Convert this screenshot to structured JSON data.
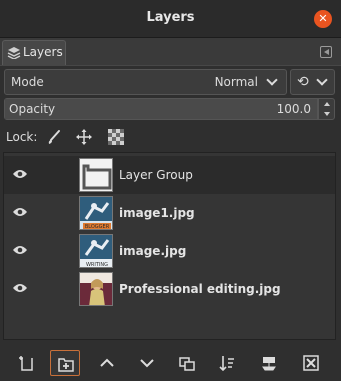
{
  "window": {
    "title": "Layers"
  },
  "dock": {
    "tab_label": "Layers"
  },
  "mode": {
    "label": "Mode",
    "value": "Normal"
  },
  "opacity": {
    "label": "Opacity",
    "value": "100.0",
    "level": 1.0
  },
  "lock": {
    "label": "Lock:"
  },
  "layers": [
    {
      "name": "Layer Group",
      "bold": false,
      "selected": true
    },
    {
      "name": "image1.jpg",
      "bold": true,
      "selected": false
    },
    {
      "name": "image.jpg",
      "bold": true,
      "selected": false
    },
    {
      "name": "Professional editing.jpg",
      "bold": true,
      "selected": false
    }
  ],
  "thumb_texts": {
    "image1": "BLOGGER",
    "image": "WRITING"
  },
  "colors": {
    "accent": "#e95420",
    "active_border": "#c8703a",
    "selected_row": "#2b2b2b"
  },
  "icons": {
    "close": "close-icon",
    "tab": "layers-icon",
    "composite": "composite-mode-icon",
    "lock_pixels": "paintbrush-icon",
    "lock_position": "move-icon",
    "lock_alpha": "checkerboard-icon",
    "visibility": "eye-icon",
    "bottom": [
      "new-layer-icon",
      "new-layer-group-icon",
      "raise-layer-icon",
      "lower-layer-icon",
      "duplicate-layer-icon",
      "merge-layer-icon",
      "anchor-layer-icon",
      "delete-layer-icon"
    ]
  }
}
